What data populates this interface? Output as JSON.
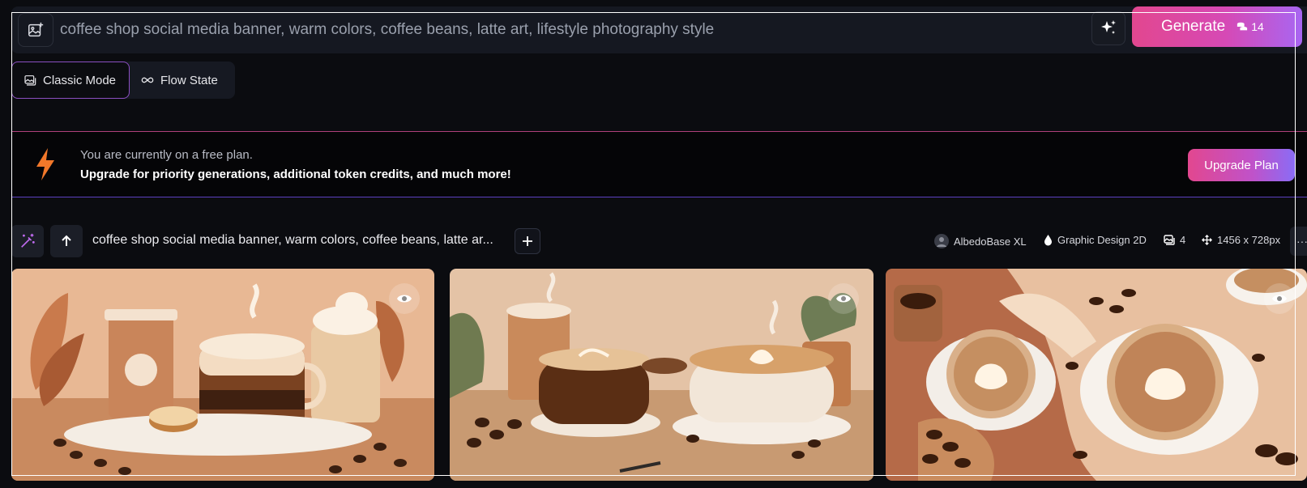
{
  "prompt": {
    "value": "coffee shop social media banner, warm colors, coffee beans, latte art, lifestyle photography style",
    "image_icon": "image-plus-icon",
    "enhance_icon": "sparkle-icon"
  },
  "generate": {
    "label": "Generate",
    "tokens": "14",
    "token_icon": "token-coins-icon"
  },
  "modes": [
    {
      "label": "Classic Mode",
      "icon": "image-icon",
      "active": true
    },
    {
      "label": "Flow State",
      "icon": "infinity-icon",
      "active": false
    }
  ],
  "banner": {
    "line1": "You are currently on a free plan.",
    "line2": "Upgrade for priority generations, additional token credits, and much more!",
    "button": "Upgrade Plan",
    "icon": "lightning-bolt-icon"
  },
  "generation": {
    "prompt_preview": "coffee shop social media banner, warm colors, coffee beans, latte ar...",
    "model": "AlbedoBase XL",
    "style": "Graphic Design 2D",
    "image_count": "4",
    "dimensions": "1456 x 728px",
    "more": "···"
  },
  "images": [
    {
      "alt": "coffee drinks illustration",
      "icon": "eye-icon"
    },
    {
      "alt": "latte cups on table",
      "icon": "eye-icon"
    },
    {
      "alt": "latte art top view",
      "icon": "eye-icon"
    }
  ],
  "colors": {
    "accent_pink": "#e2478f",
    "accent_purple": "#a866f2",
    "bolt_orange": "#f2782a",
    "background": "#0b0c10"
  }
}
